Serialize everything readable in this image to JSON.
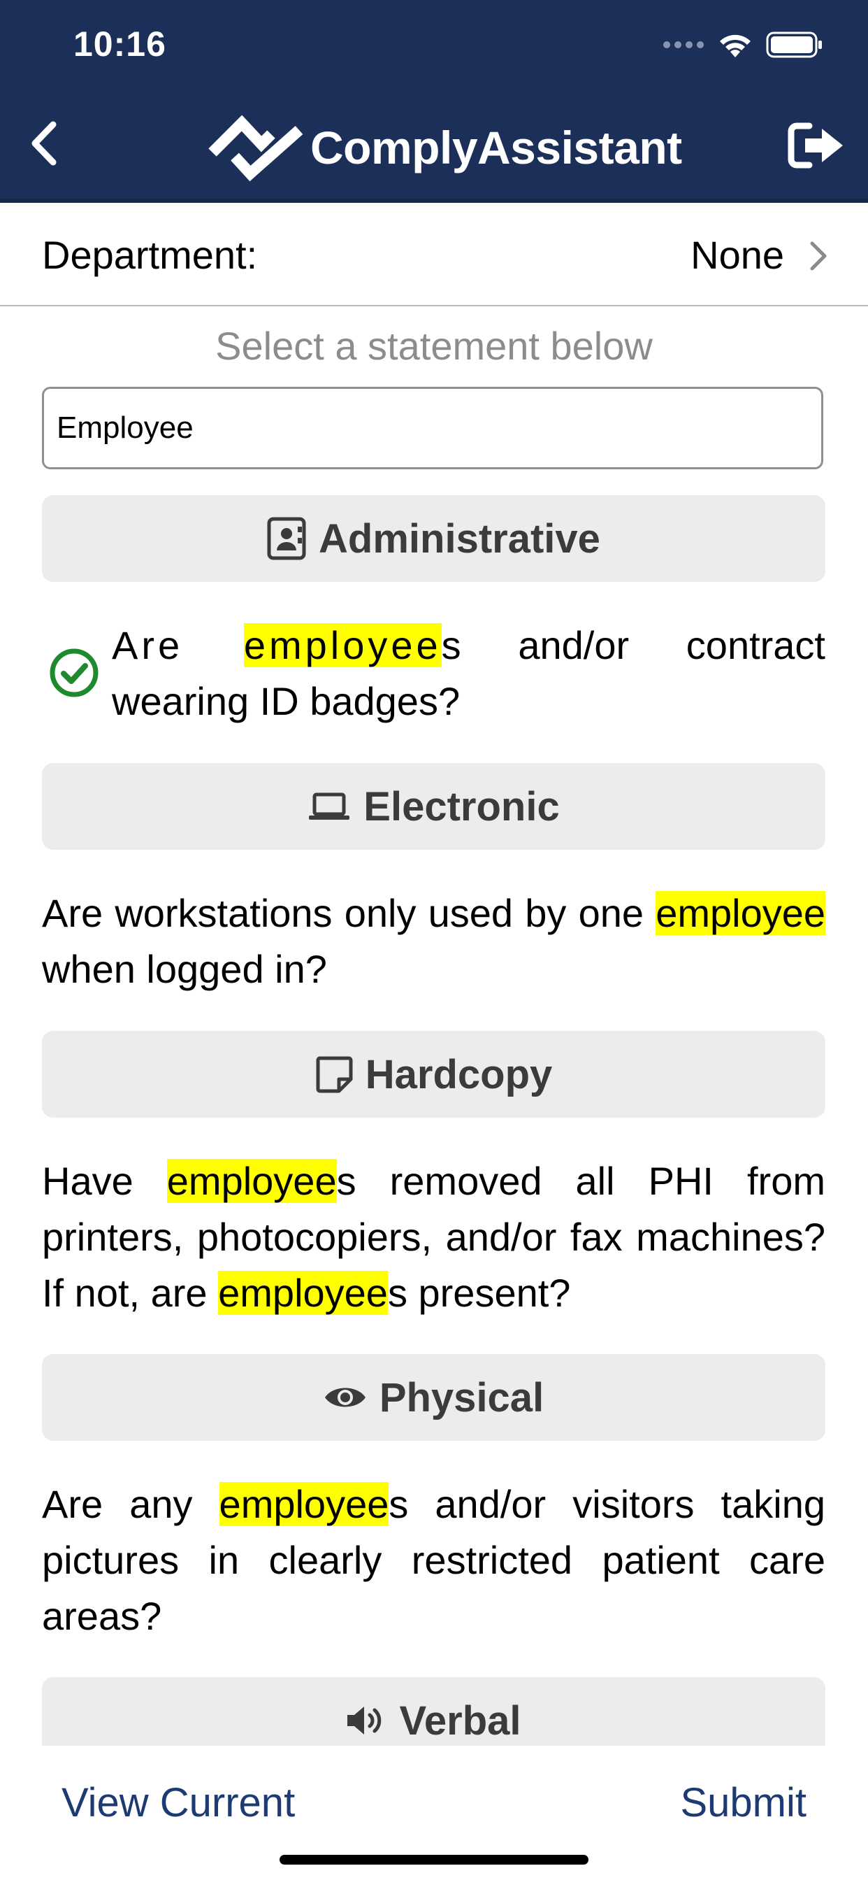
{
  "status_bar": {
    "time": "10:16"
  },
  "nav": {
    "brand": "ComplyAssistant",
    "back_icon": "chevron-left-icon",
    "logout_icon": "sign-out-icon"
  },
  "department": {
    "label": "Department:",
    "value": "None"
  },
  "hint": "Select a statement below",
  "search": {
    "value": "Employee"
  },
  "sections": [
    {
      "label": "Administrative",
      "icon": "id-badge-icon",
      "question": {
        "parts": [
          {
            "t": "Are "
          },
          {
            "t": "employee",
            "hl": true
          },
          {
            "t": "s and/or contract wearing ID badges?"
          }
        ],
        "checked": true
      }
    },
    {
      "label": "Electronic",
      "icon": "laptop-icon",
      "question": {
        "parts": [
          {
            "t": "Are workstations only used by one "
          },
          {
            "t": "employee",
            "hl": true
          },
          {
            "t": " when logged in?"
          }
        ]
      }
    },
    {
      "label": "Hardcopy",
      "icon": "sticky-note-icon",
      "question": {
        "parts": [
          {
            "t": "Have "
          },
          {
            "t": "employee",
            "hl": true
          },
          {
            "t": "s removed all PHI from printers, photocopiers, and/or fax machines? If not, are "
          },
          {
            "t": "employee",
            "hl": true
          },
          {
            "t": "s present?"
          }
        ]
      }
    },
    {
      "label": "Physical",
      "icon": "eye-icon",
      "question": {
        "parts": [
          {
            "t": "Are any "
          },
          {
            "t": "employee",
            "hl": true
          },
          {
            "t": "s and/or visitors taking pictures in clearly restricted patient care areas?"
          }
        ]
      }
    },
    {
      "label": "Verbal",
      "icon": "volume-icon"
    }
  ],
  "footer": {
    "view_current": "View Current",
    "submit": "Submit"
  },
  "colors": {
    "nav": "#1b2f58",
    "highlight": "#ffff00",
    "check": "#1e8a2e",
    "link": "#1d3a72"
  }
}
